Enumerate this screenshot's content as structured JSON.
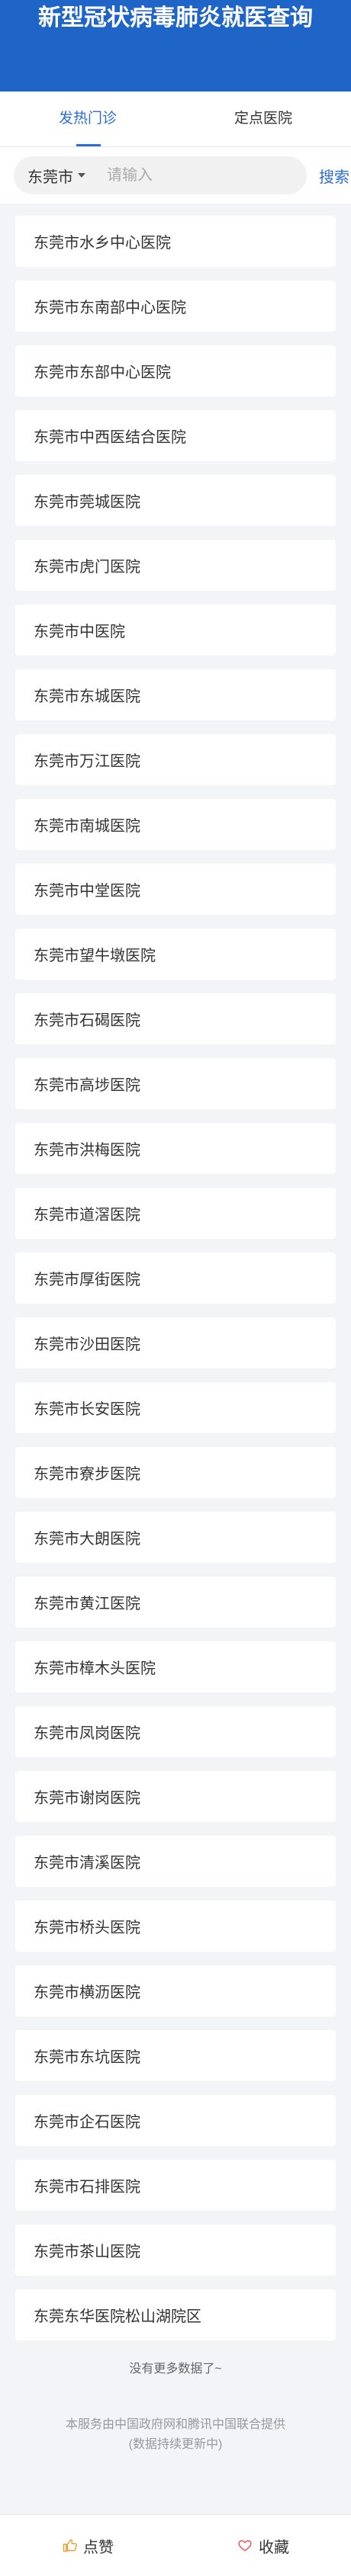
{
  "header": {
    "title": "新型冠状病毒肺炎就医查询"
  },
  "tabs": [
    {
      "label": "发热门诊"
    },
    {
      "label": "定点医院"
    }
  ],
  "search": {
    "city": "东莞市",
    "placeholder": "请输入",
    "button_label": "搜索"
  },
  "hospitals": [
    "东莞市水乡中心医院",
    "东莞市东南部中心医院",
    "东莞市东部中心医院",
    "东莞市中西医结合医院",
    "东莞市莞城医院",
    "东莞市虎门医院",
    "东莞市中医院",
    "东莞市东城医院",
    "东莞市万江医院",
    "东莞市南城医院",
    "东莞市中堂医院",
    "东莞市望牛墩医院",
    "东莞市石碣医院",
    "东莞市高埗医院",
    "东莞市洪梅医院",
    "东莞市道滘医院",
    "东莞市厚街医院",
    "东莞市沙田医院",
    "东莞市长安医院",
    "东莞市寮步医院",
    "东莞市大朗医院",
    "东莞市黄江医院",
    "东莞市樟木头医院",
    "东莞市凤岗医院",
    "东莞市谢岗医院",
    "东莞市清溪医院",
    "东莞市桥头医院",
    "东莞市横沥医院",
    "东莞市东坑医院",
    "东莞市企石医院",
    "东莞市石排医院",
    "东莞市茶山医院",
    "东莞东华医院松山湖院区"
  ],
  "list_end": "没有更多数据了~",
  "footer": {
    "line1": "本服务由中国政府网和腾讯中国联合提供",
    "line2": "(数据持续更新中)"
  },
  "bottom_bar": {
    "like_label": "点赞",
    "favorite_label": "收藏"
  },
  "colors": {
    "header_bg": "#1f65c8",
    "accent": "#2b6fd6",
    "page_bg": "#f2f4f7"
  }
}
